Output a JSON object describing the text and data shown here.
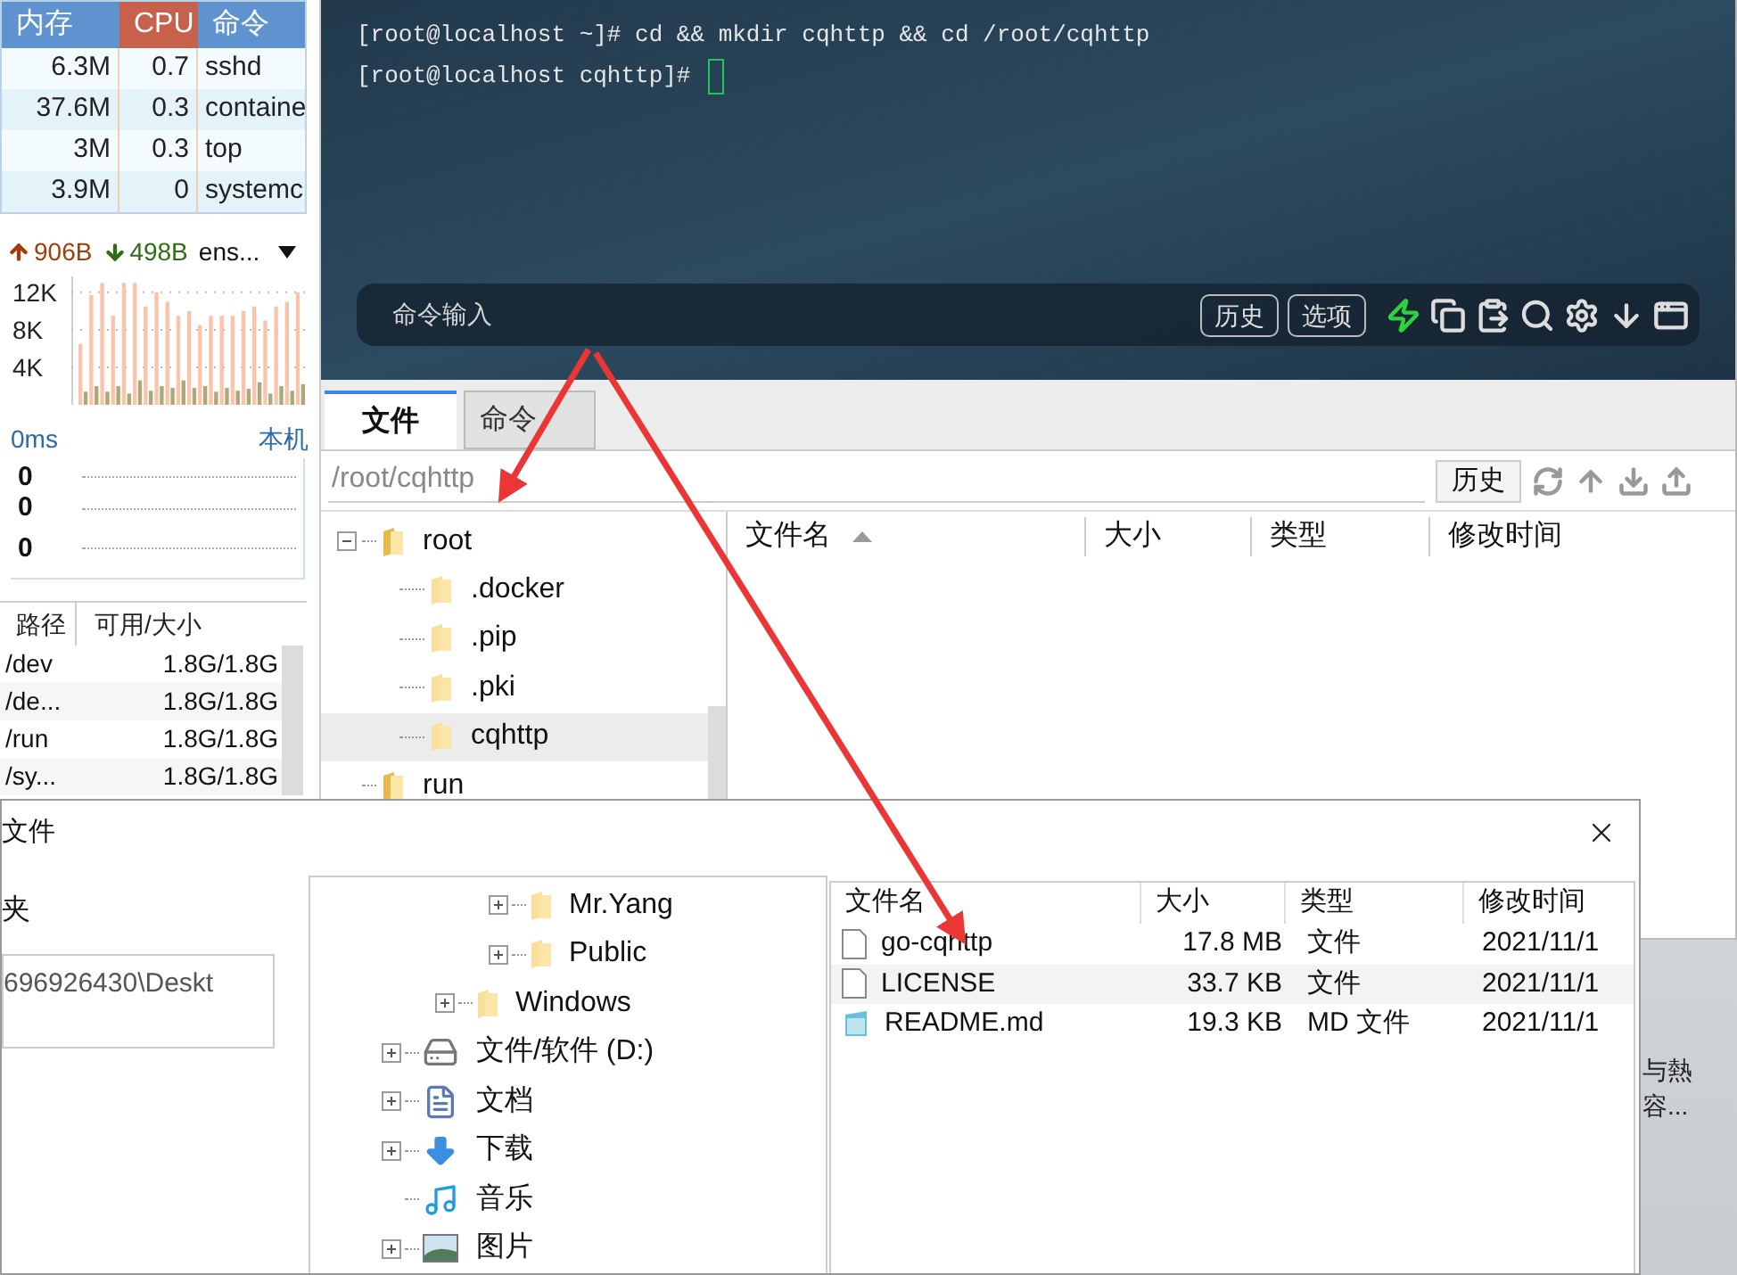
{
  "monitor": {
    "process_table": {
      "columns": [
        {
          "label": "内存",
          "selected": false
        },
        {
          "label": "CPU",
          "selected": true
        },
        {
          "label": "命令",
          "selected": false
        }
      ],
      "rows": [
        [
          "6.3M",
          "0.7",
          "sshd"
        ],
        [
          "37.6M",
          "0.3",
          "containe"
        ],
        [
          "3M",
          "0.3",
          "top"
        ],
        [
          "3.9M",
          "0",
          "systemc"
        ]
      ]
    },
    "network": {
      "upload": "906B",
      "download": "498B",
      "interface": "ens...",
      "chart_data": {
        "type": "bar",
        "grid": true,
        "stacked": false,
        "ylim": [
          0,
          13700
        ],
        "yticks": [
          {
            "value": 4000,
            "label": "4K"
          },
          {
            "value": 8000,
            "label": "8K"
          },
          {
            "value": 12000,
            "label": "12K"
          }
        ],
        "series": [
          {
            "color": "#f9c4aa",
            "values": [
              6500,
              11700,
              13000,
              9500,
              13000,
              13000,
              10500,
              12000,
              11000,
              9500,
              10000,
              8500,
              9500,
              9500,
              9500,
              10000,
              10500,
              9000,
              10500,
              11000,
              12000
            ]
          },
          {
            "color": "#b0a67c",
            "values": [
              1400,
              2000,
              1400,
              2000,
              1200,
              2600,
              1500,
              2000,
              1800,
              2600,
              1800,
              2000,
              1400,
              1800,
              1500,
              1700,
              2400,
              1200,
              2000,
              1500,
              2200
            ]
          }
        ]
      }
    },
    "ping": {
      "latency": "0ms",
      "host": "本机",
      "axis_labels": [
        "0",
        "0",
        "0"
      ]
    },
    "disks": {
      "columns": [
        "路径",
        "可用/大小"
      ],
      "rows": [
        [
          "/dev",
          "1.8G/1.8G"
        ],
        [
          "/de...",
          "1.8G/1.8G"
        ],
        [
          "/run",
          "1.8G/1.8G"
        ],
        [
          "/sy...",
          "1.8G/1.8G"
        ]
      ]
    }
  },
  "terminal": {
    "lines": [
      "[root@localhost ~]# cd && mkdir cqhttp && cd /root/cqhttp",
      "[root@localhost cqhttp]#"
    ],
    "command_input": {
      "placeholder": "命令输入"
    },
    "buttons": [
      "历史",
      "选项"
    ]
  },
  "tabs": [
    {
      "label": "文件",
      "selected": true
    },
    {
      "label": "命令",
      "selected": false
    }
  ],
  "path_bar": {
    "value": "/root/cqhttp",
    "history_button": "历史"
  },
  "remote_tree": [
    {
      "label": "root",
      "expanded": true,
      "selected": false,
      "children": [
        {
          "label": ".docker",
          "selected": false
        },
        {
          "label": ".pip",
          "selected": false
        },
        {
          "label": ".pki",
          "selected": false
        },
        {
          "label": "cqhttp",
          "selected": true
        }
      ]
    },
    {
      "label": "run",
      "selected": false
    }
  ],
  "remote_files": {
    "columns": [
      {
        "label": "文件名",
        "sorted": true
      },
      {
        "label": "大小",
        "sorted": false
      },
      {
        "label": "类型",
        "sorted": false
      },
      {
        "label": "修改时间",
        "sorted": false
      }
    ]
  },
  "dialog": {
    "title": "文件",
    "folder_label": "夹",
    "folder_path": "696926430\\Deskt",
    "tree": [
      {
        "children": [
          {
            "children": [
              {
                "label": "Mr.Yang",
                "kind": "folder",
                "expandable": true
              },
              {
                "label": "Public",
                "kind": "folder",
                "expandable": true
              }
            ]
          },
          {
            "label": "Windows",
            "kind": "folder",
            "expandable": true
          }
        ]
      },
      {
        "label": "文件/软件 (D:)",
        "kind": "drive",
        "expandable": true
      },
      {
        "label": "文档",
        "kind": "document",
        "expandable": true
      },
      {
        "label": "下载",
        "kind": "download",
        "expandable": true
      },
      {
        "label": "音乐",
        "kind": "music",
        "expandable": false
      },
      {
        "label": "图片",
        "kind": "pictures",
        "expandable": true
      }
    ],
    "file_list": {
      "columns": [
        "文件名",
        "大小",
        "类型",
        "修改时间"
      ],
      "rows": [
        {
          "name": "go-cqhttp",
          "size": "17.8 MB",
          "type": "文件",
          "modified": "2021/11/1",
          "kind": "file",
          "highlighted": false
        },
        {
          "name": "LICENSE",
          "size": "33.7 KB",
          "type": "文件",
          "modified": "2021/11/1",
          "kind": "file",
          "highlighted": true
        },
        {
          "name": "README.md",
          "size": "19.3 KB",
          "type": "MD 文件",
          "modified": "2021/11/1",
          "kind": "markdown",
          "highlighted": false
        }
      ]
    }
  },
  "desktop_labels": [
    "与熱",
    "容..."
  ]
}
